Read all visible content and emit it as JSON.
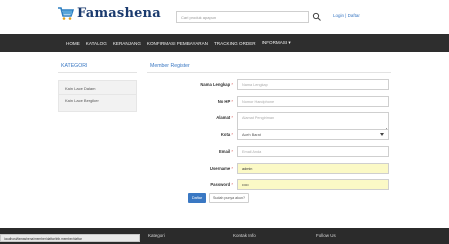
{
  "header": {
    "brand": "Famashena",
    "search_placeholder": "Cari produk apapun",
    "login_label": "Login | Daftar"
  },
  "nav": {
    "items": [
      "HOME",
      "KATALOG",
      "KERANJANG",
      "KONFIRMASI PEMBAYARAN",
      "TRACKING ORDER",
      "INFORMASI"
    ]
  },
  "sidebar": {
    "title": "KATEGORI",
    "items": [
      "Kain Lace Dalam",
      "Kain Lace Bergiker"
    ]
  },
  "main": {
    "title": "Member Register",
    "fields": {
      "nama": {
        "label": "Nama Lengkap",
        "placeholder": "Nama Lengkap"
      },
      "nohp": {
        "label": "No HP",
        "placeholder": "Nomor Handphone"
      },
      "alamat": {
        "label": "Alamat",
        "placeholder": "Alamat Pengiriman"
      },
      "kota": {
        "label": "Kota",
        "value": "Aceh Barat"
      },
      "email": {
        "label": "Email",
        "placeholder": "Email Anda"
      },
      "username": {
        "label": "Username",
        "value": "admin"
      },
      "password": {
        "label": "Password",
        "value": "•••••"
      }
    },
    "required_marker": "*",
    "submit_label": "Daftar",
    "login_link_label": "Sudah punya akun?"
  },
  "footer": {
    "items": [
      "Kategori",
      "Kontak Info",
      "Follow Us"
    ]
  },
  "statusbar": {
    "text": "localhost/famashena/member/daftar/trib.member/daftar"
  },
  "colors": {
    "accent": "#3a78c3",
    "nav_bg": "#2e2e2e",
    "brand": "#1a3a6e",
    "autofill_bg": "#fbf9c6"
  }
}
